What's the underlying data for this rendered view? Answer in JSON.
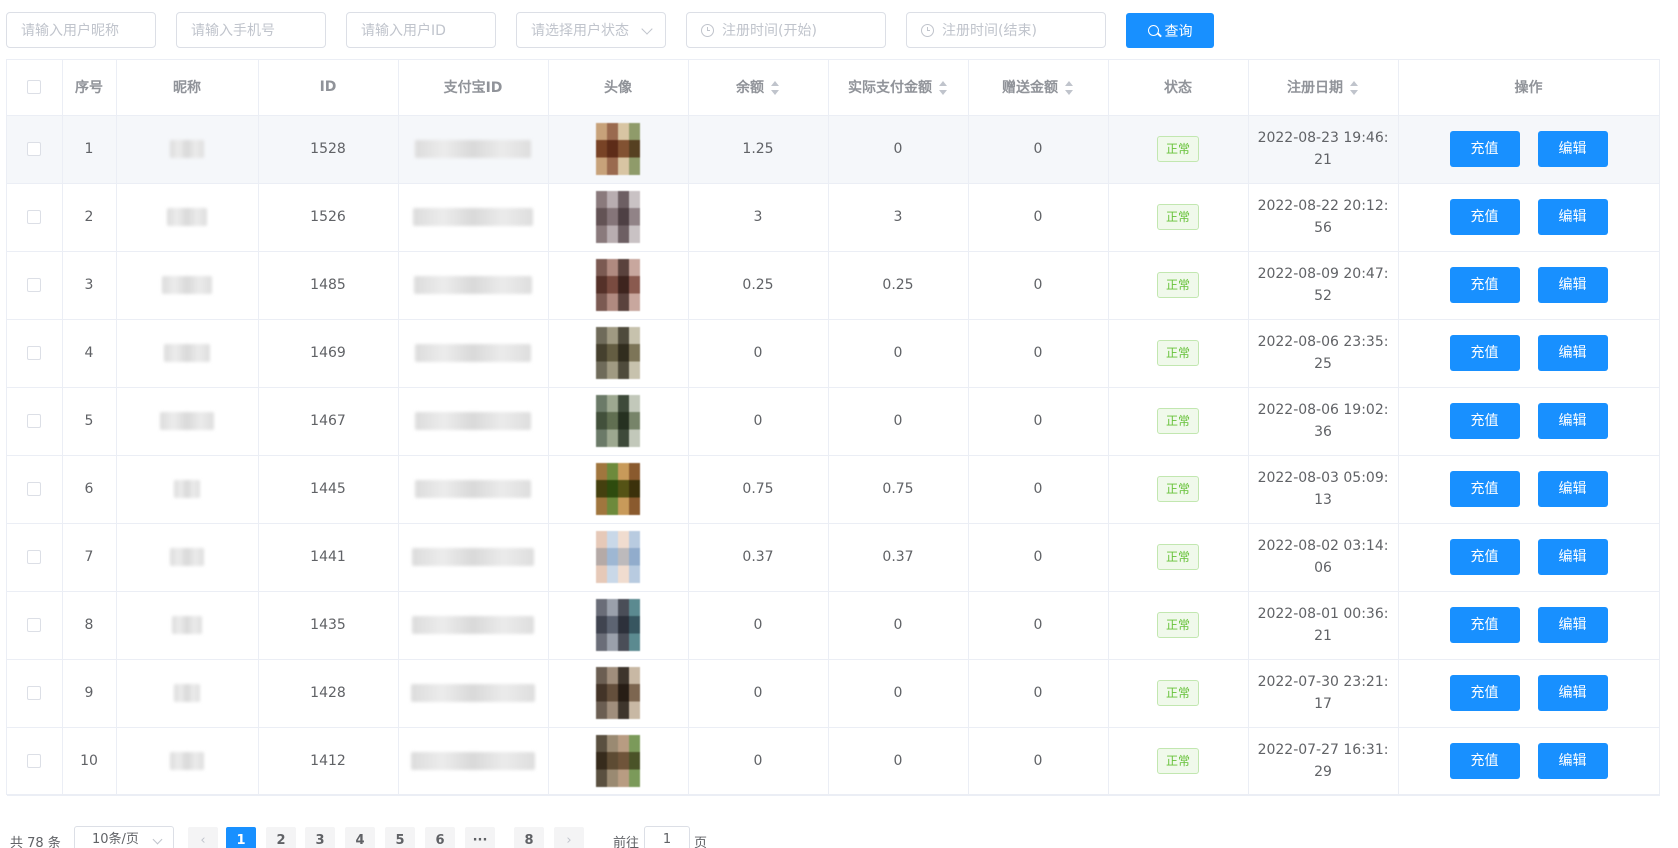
{
  "filters": {
    "nickname_placeholder": "请输入用户昵称",
    "phone_placeholder": "请输入手机号",
    "userid_placeholder": "请输入用户ID",
    "status_placeholder": "请选择用户状态",
    "start_placeholder": "注册时间(开始)",
    "end_placeholder": "注册时间(结束)",
    "query_label": "查询"
  },
  "table": {
    "headers": {
      "index": "序号",
      "nickname": "昵称",
      "id": "ID",
      "alipay": "支付宝ID",
      "avatar": "头像",
      "balance": "余额",
      "paid": "实际支付金额",
      "gift": "赠送金额",
      "status": "状态",
      "reg_date": "注册日期",
      "actions": "操作"
    },
    "rows": [
      {
        "index": "1",
        "id": "1528",
        "balance": "1.25",
        "paid": "0",
        "gift": "0",
        "status": "正常",
        "date": "2022-08-23 19:46:21",
        "recharge": "充值",
        "edit": "编辑"
      },
      {
        "index": "2",
        "id": "1526",
        "balance": "3",
        "paid": "3",
        "gift": "0",
        "status": "正常",
        "date": "2022-08-22 20:12:56",
        "recharge": "充值",
        "edit": "编辑"
      },
      {
        "index": "3",
        "id": "1485",
        "balance": "0.25",
        "paid": "0.25",
        "gift": "0",
        "status": "正常",
        "date": "2022-08-09 20:47:52",
        "recharge": "充值",
        "edit": "编辑"
      },
      {
        "index": "4",
        "id": "1469",
        "balance": "0",
        "paid": "0",
        "gift": "0",
        "status": "正常",
        "date": "2022-08-06 23:35:25",
        "recharge": "充值",
        "edit": "编辑"
      },
      {
        "index": "5",
        "id": "1467",
        "balance": "0",
        "paid": "0",
        "gift": "0",
        "status": "正常",
        "date": "2022-08-06 19:02:36",
        "recharge": "充值",
        "edit": "编辑"
      },
      {
        "index": "6",
        "id": "1445",
        "balance": "0.75",
        "paid": "0.75",
        "gift": "0",
        "status": "正常",
        "date": "2022-08-03 05:09:13",
        "recharge": "充值",
        "edit": "编辑"
      },
      {
        "index": "7",
        "id": "1441",
        "balance": "0.37",
        "paid": "0.37",
        "gift": "0",
        "status": "正常",
        "date": "2022-08-02 03:14:06",
        "recharge": "充值",
        "edit": "编辑"
      },
      {
        "index": "8",
        "id": "1435",
        "balance": "0",
        "paid": "0",
        "gift": "0",
        "status": "正常",
        "date": "2022-08-01 00:36:21",
        "recharge": "充值",
        "edit": "编辑"
      },
      {
        "index": "9",
        "id": "1428",
        "balance": "0",
        "paid": "0",
        "gift": "0",
        "status": "正常",
        "date": "2022-07-30 23:21:17",
        "recharge": "充值",
        "edit": "编辑"
      },
      {
        "index": "10",
        "id": "1412",
        "balance": "0",
        "paid": "0",
        "gift": "0",
        "status": "正常",
        "date": "2022-07-27 16:31:29",
        "recharge": "充值",
        "edit": "编辑"
      }
    ]
  },
  "pagination": {
    "total": "共 78 条",
    "page_size": "10条/页",
    "prev": "‹",
    "next": "›",
    "pages": [
      "1",
      "2",
      "3",
      "4",
      "5",
      "6"
    ],
    "ellipsis": "···",
    "last": "8",
    "goto_label": "前往",
    "goto_value": "1",
    "page_unit": "页"
  },
  "colors": {
    "primary": "#1890ff",
    "success": "#67c23a",
    "border": "#ebeef5"
  }
}
